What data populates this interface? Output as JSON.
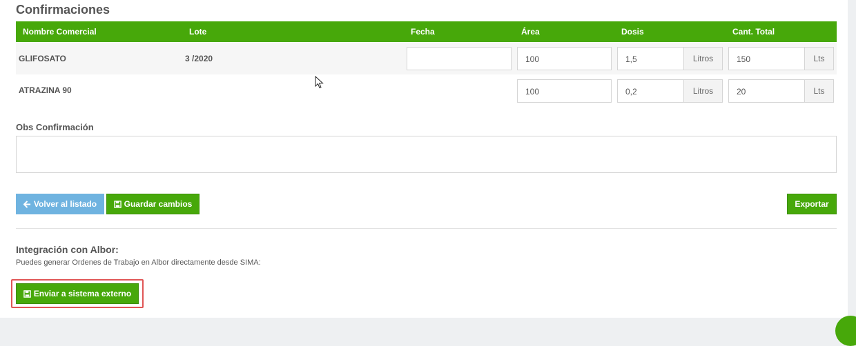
{
  "section": {
    "title": "Confirmaciones"
  },
  "table": {
    "headers": [
      "Nombre Comercial",
      "Lote",
      "Fecha",
      "Área",
      "Dosis",
      "Cant. Total"
    ],
    "rows": [
      {
        "nombre": "GLIFOSATO",
        "lote": "3 /2020",
        "fecha": "",
        "area": "100",
        "dosis": "1,5",
        "dosis_unit": "Litros",
        "total": "150",
        "total_unit": "Lts"
      },
      {
        "nombre": "ATRAZINA 90",
        "lote": "",
        "area": "100",
        "dosis": "0,2",
        "dosis_unit": "Litros",
        "total": "20",
        "total_unit": "Lts"
      }
    ]
  },
  "obs": {
    "label": "Obs Confirmación",
    "value": ""
  },
  "buttons": {
    "back": "Volver al listado",
    "save": "Guardar cambios",
    "export": "Exportar",
    "send": "Enviar a sistema externo"
  },
  "integration": {
    "title": "Integración con Albor:",
    "description": "Puedes generar Ordenes de Trabajo en Albor directamente desde SIMA:"
  },
  "colors": {
    "primary_green": "#47a80a",
    "info_blue": "#6fb3e0",
    "highlight_red": "#e05555"
  },
  "icons": {
    "back": "arrow-left-icon",
    "save": "floppy-disk-icon",
    "send": "floppy-disk-icon"
  }
}
